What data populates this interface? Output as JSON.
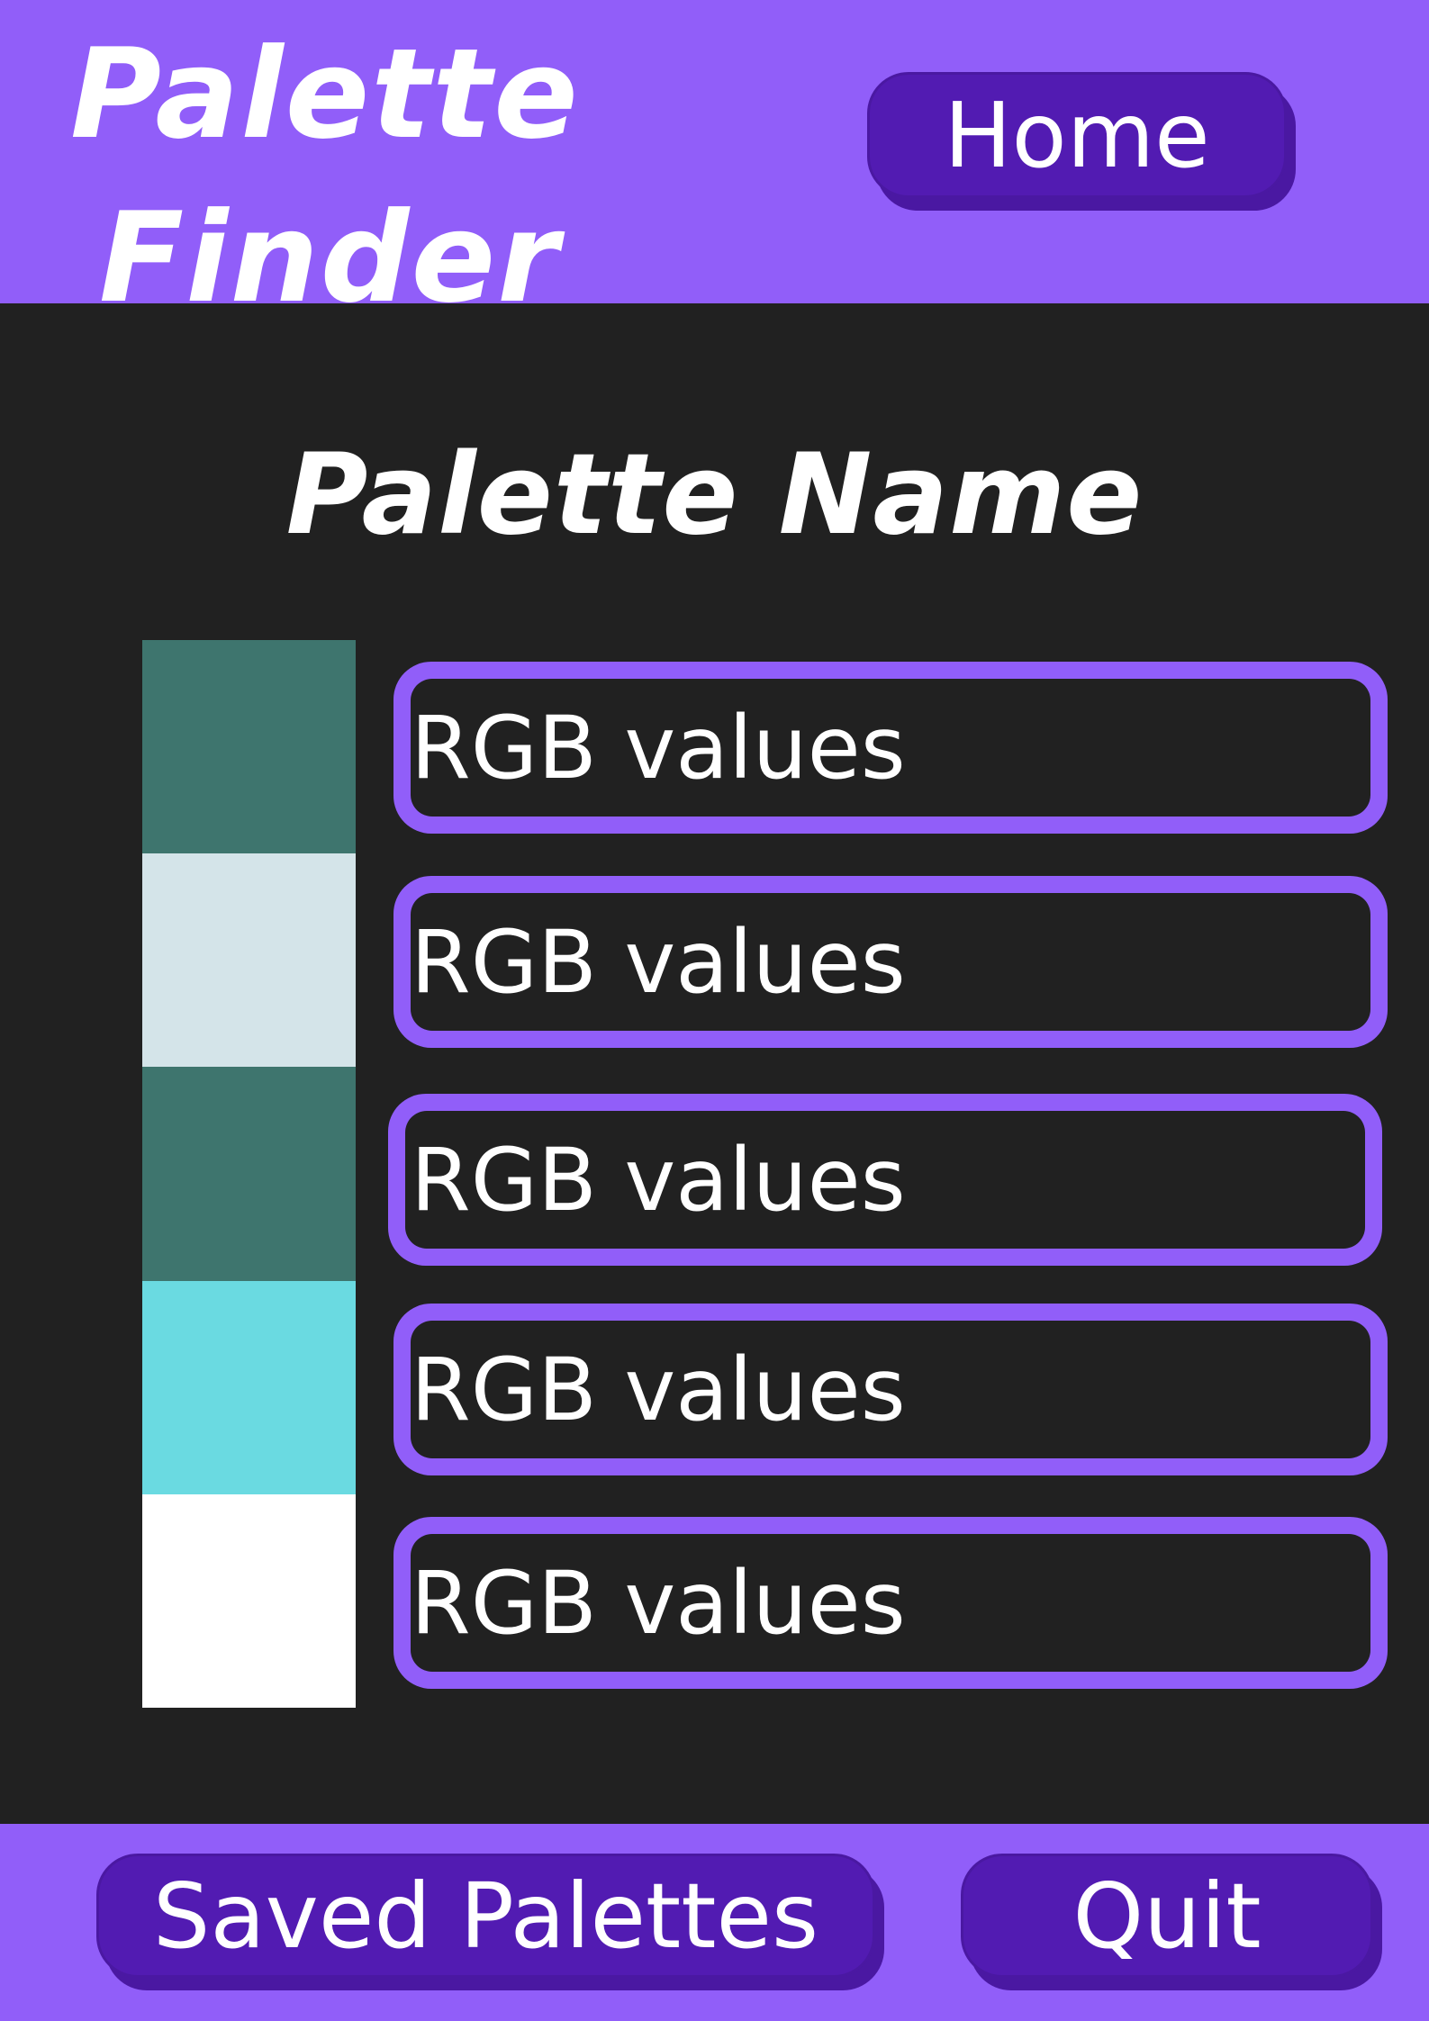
{
  "header": {
    "title_line_1": "Palette",
    "title_line_2": "Finder",
    "home_label": "Home"
  },
  "main": {
    "palette_name": "Palette Name",
    "swatches": [
      {
        "color": "#3e756e",
        "rgb_label": "RGB values"
      },
      {
        "color": "#d4e4e9",
        "rgb_label": "RGB values"
      },
      {
        "color": "#3e756e",
        "rgb_label": "RGB values"
      },
      {
        "color": "#6adae1",
        "rgb_label": "RGB values"
      },
      {
        "color": "#ffffff",
        "rgb_label": "RGB values"
      }
    ]
  },
  "footer": {
    "saved_palettes_label": "Saved Palettes",
    "quit_label": "Quit"
  },
  "colors": {
    "accent": "#915ef9",
    "button_fill": "#521bb2",
    "background": "#212121",
    "text": "#ffffff"
  }
}
